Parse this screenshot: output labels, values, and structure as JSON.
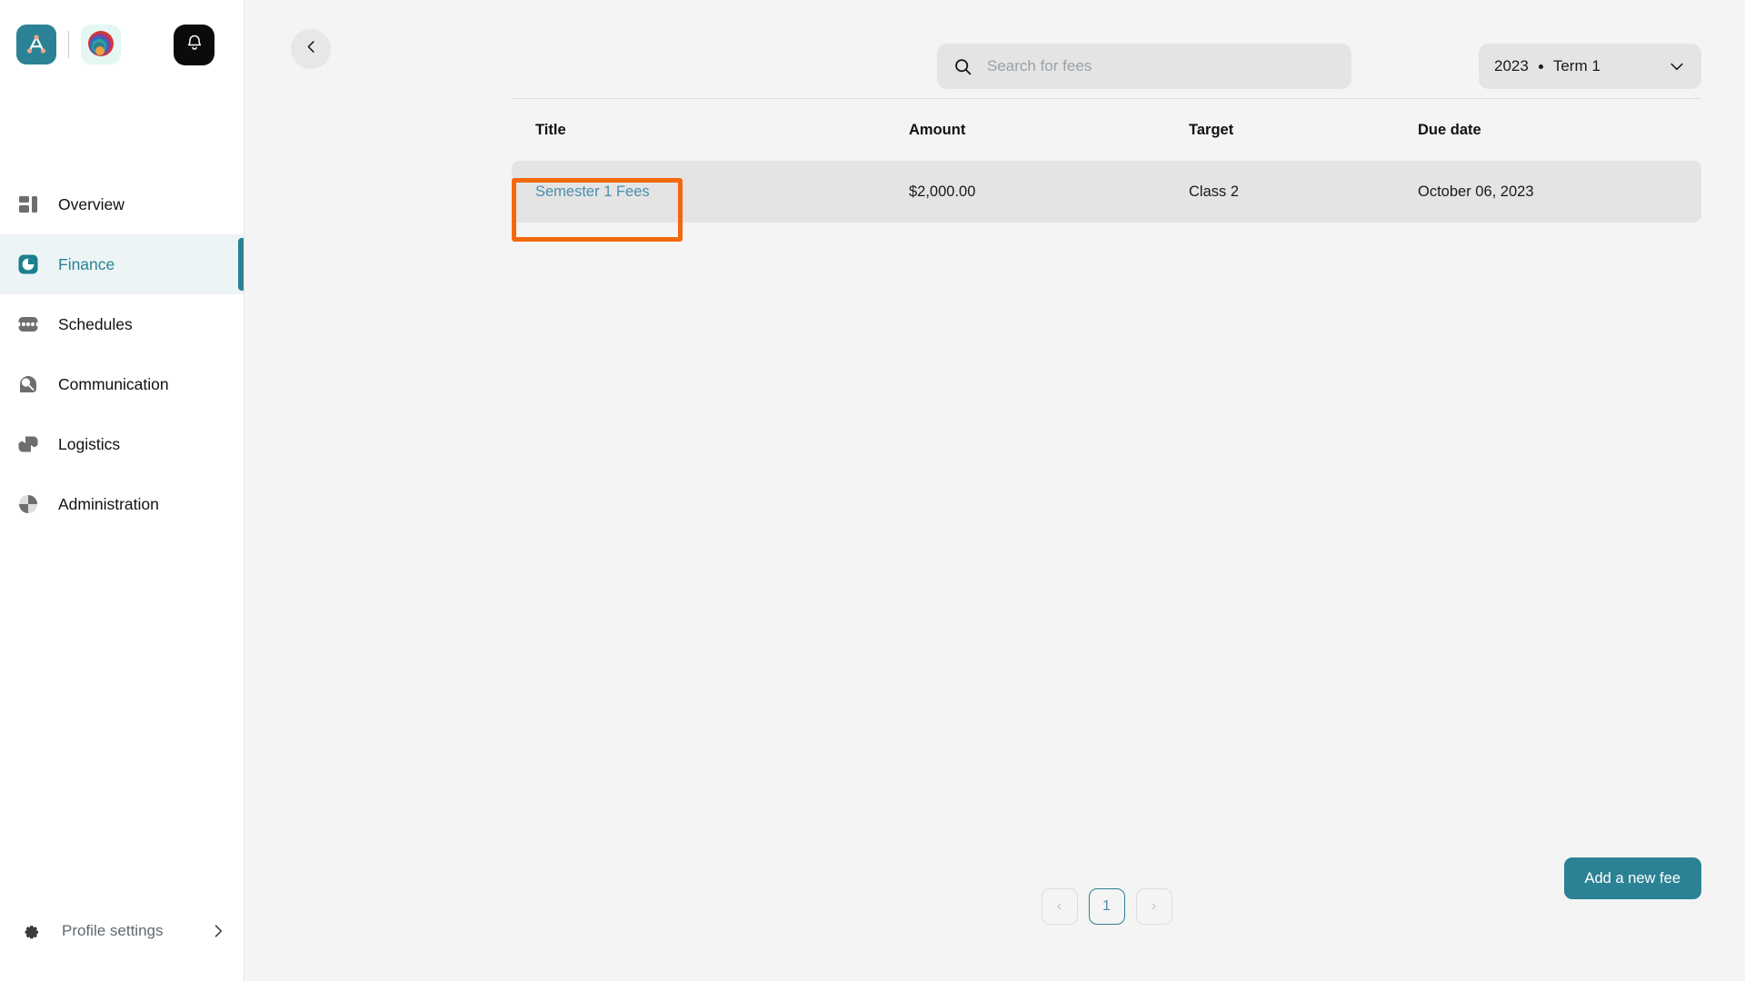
{
  "sidebar": {
    "brand": {
      "logo_primary": "logo-a-icon",
      "logo_secondary": "rainbow-emblem-icon",
      "notifications_icon": "bell-icon"
    },
    "items": [
      {
        "label": "Overview",
        "icon": "overview-icon",
        "active": false
      },
      {
        "label": "Finance",
        "icon": "finance-pie-icon",
        "active": true
      },
      {
        "label": "Schedules",
        "icon": "schedules-icon",
        "active": false
      },
      {
        "label": "Communication",
        "icon": "communication-icon",
        "active": false
      },
      {
        "label": "Logistics",
        "icon": "logistics-box-icon",
        "active": false
      },
      {
        "label": "Administration",
        "icon": "administration-icon",
        "active": false
      }
    ],
    "footer": {
      "label": "Profile settings",
      "icon": "gear-icon",
      "chevron": "chevron-right-icon"
    }
  },
  "topbar": {
    "back_icon": "chevron-left-icon",
    "search": {
      "icon": "search-icon",
      "placeholder": "Search for fees",
      "value": ""
    },
    "term_selector": {
      "year": "2023",
      "separator": "•",
      "term": "Term 1",
      "chevron": "chevron-down-icon"
    }
  },
  "table": {
    "columns": [
      "Title",
      "Amount",
      "Target",
      "Due date"
    ],
    "rows": [
      {
        "title": "Semester 1 Fees",
        "amount": "$2,000.00",
        "target": "Class 2",
        "due_date": "October 06, 2023"
      }
    ]
  },
  "pagination": {
    "prev": "‹",
    "pages": [
      "1"
    ],
    "current": "1",
    "next": "›"
  },
  "actions": {
    "add_fee_label": "Add a new fee"
  },
  "colors": {
    "accent_teal": "#2b8295",
    "link_blue": "#4a8fad",
    "highlight_orange": "#f4680c",
    "active_nav_bg": "#ecf4f5",
    "row_bg": "#e4e4e4",
    "canvas": "#f4f4f4"
  }
}
